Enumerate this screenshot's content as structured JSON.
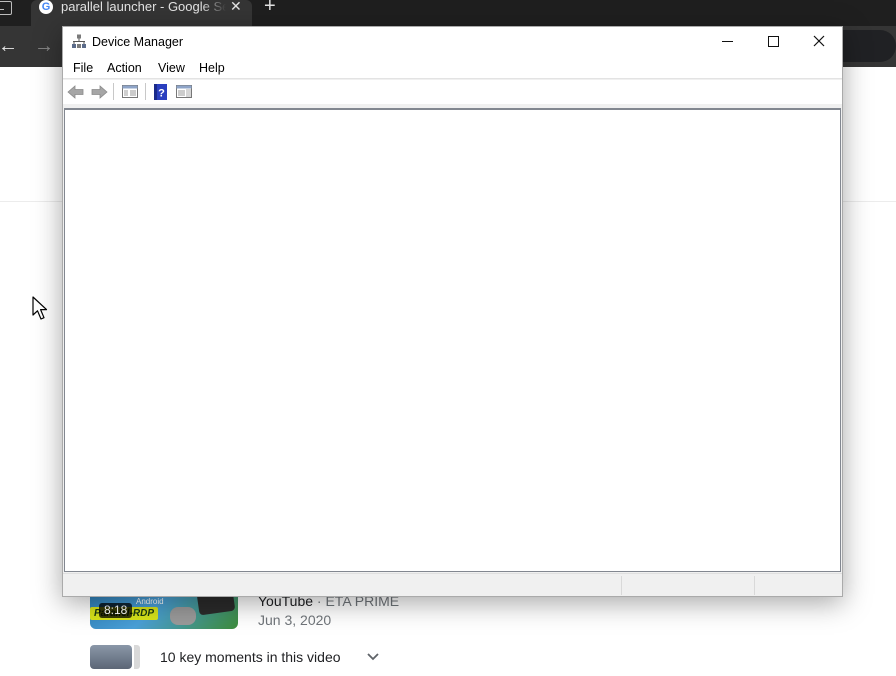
{
  "browser": {
    "tab": {
      "title": "parallel launcher - Google Search",
      "favicon": "G",
      "close_glyph": "✕"
    },
    "new_tab_glyph": "+",
    "nav": {
      "back_glyph": "←",
      "forward_glyph": "→"
    },
    "icons": [
      "tab-strip-icon",
      "google-favicon-icon",
      "close-icon",
      "plus-icon",
      "back-arrow-icon",
      "forward-arrow-icon"
    ]
  },
  "search_result": {
    "thumbnail": {
      "duration": "8:18",
      "overlay_logo": "Parallel-RDP",
      "overlay_sub": "Android"
    },
    "source": "YouTube",
    "separator": "·",
    "channel": "ETA PRIME",
    "date": "Jun 3, 2020",
    "key_moments": {
      "label": "10 key moments in this video",
      "icon": "chevron-down-icon"
    }
  },
  "device_manager": {
    "title": "Device Manager",
    "window_controls": [
      "minimize-icon",
      "maximize-icon",
      "close-icon"
    ],
    "menu": {
      "file": "File",
      "action": "Action",
      "view": "View",
      "help": "Help"
    },
    "toolbar_icons": [
      "back-icon",
      "forward-icon",
      "show-hide-console-tree-icon",
      "help-icon",
      "action-pane-icon"
    ],
    "colors": {
      "help_icon": "#2a3fbf",
      "arrow_icon": "#9a9a9a",
      "window_frame": "#f0f0f0"
    }
  },
  "colors": {
    "chrome_tabbar": "#1f1f1f",
    "chrome_toolbar": "#353535",
    "page_background": "#ffffff"
  }
}
